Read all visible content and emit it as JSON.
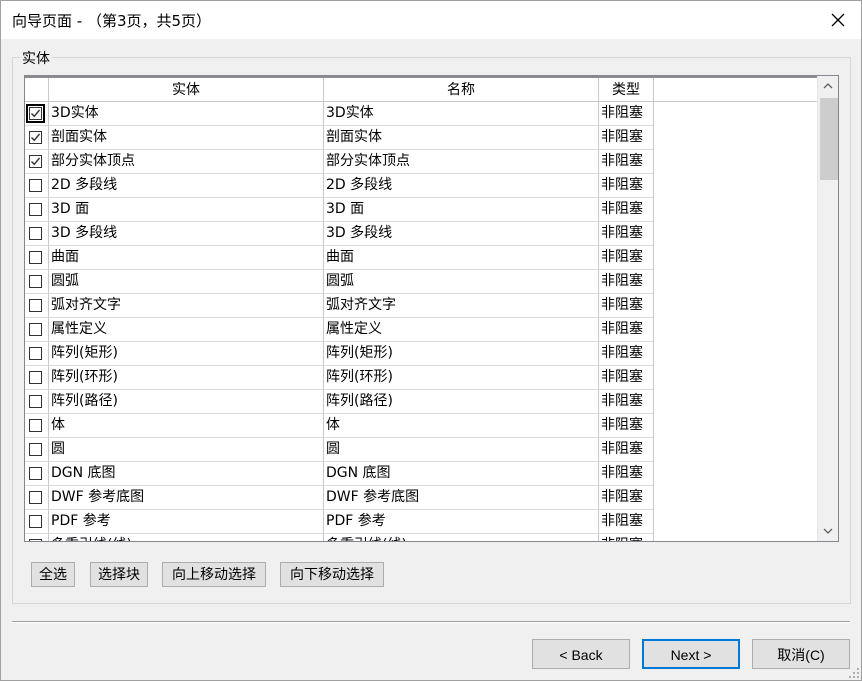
{
  "window": {
    "title": "向导页面 - （第3页，共5页）",
    "close_icon": "close-icon"
  },
  "group": {
    "label": "实体"
  },
  "grid": {
    "headers": {
      "entity": "实体",
      "name": "名称",
      "type": "类型"
    },
    "rows": [
      {
        "checked": true,
        "entity": "3D实体",
        "name": "3D实体",
        "type": "非阻塞"
      },
      {
        "checked": true,
        "entity": "剖面实体",
        "name": "剖面实体",
        "type": "非阻塞"
      },
      {
        "checked": true,
        "entity": "部分实体顶点",
        "name": "部分实体顶点",
        "type": "非阻塞"
      },
      {
        "checked": false,
        "entity": "2D 多段线",
        "name": "2D 多段线",
        "type": "非阻塞"
      },
      {
        "checked": false,
        "entity": "3D 面",
        "name": "3D 面",
        "type": "非阻塞"
      },
      {
        "checked": false,
        "entity": "3D 多段线",
        "name": "3D 多段线",
        "type": "非阻塞"
      },
      {
        "checked": false,
        "entity": "曲面",
        "name": "曲面",
        "type": "非阻塞"
      },
      {
        "checked": false,
        "entity": "圆弧",
        "name": "圆弧",
        "type": "非阻塞"
      },
      {
        "checked": false,
        "entity": "弧对齐文字",
        "name": "弧对齐文字",
        "type": "非阻塞"
      },
      {
        "checked": false,
        "entity": "属性定义",
        "name": "属性定义",
        "type": "非阻塞"
      },
      {
        "checked": false,
        "entity": "阵列(矩形)",
        "name": "阵列(矩形)",
        "type": "非阻塞"
      },
      {
        "checked": false,
        "entity": "阵列(环形)",
        "name": "阵列(环形)",
        "type": "非阻塞"
      },
      {
        "checked": false,
        "entity": "阵列(路径)",
        "name": "阵列(路径)",
        "type": "非阻塞"
      },
      {
        "checked": false,
        "entity": "体",
        "name": "体",
        "type": "非阻塞"
      },
      {
        "checked": false,
        "entity": "圆",
        "name": "圆",
        "type": "非阻塞"
      },
      {
        "checked": false,
        "entity": "DGN 底图",
        "name": "DGN 底图",
        "type": "非阻塞"
      },
      {
        "checked": false,
        "entity": "DWF 参考底图",
        "name": "DWF 参考底图",
        "type": "非阻塞"
      },
      {
        "checked": false,
        "entity": "PDF 参考",
        "name": "PDF 参考",
        "type": "非阻塞"
      },
      {
        "checked": false,
        "entity": "多重引线(线)",
        "name": "多重引线(线)",
        "type": "非阻塞"
      }
    ]
  },
  "actions": {
    "select_all": "全选",
    "select_block": "选择块",
    "move_up": "向上移动选择",
    "move_down": "向下移动选择"
  },
  "footer": {
    "back": "< Back",
    "next": "Next >",
    "cancel": "取消(C)"
  }
}
